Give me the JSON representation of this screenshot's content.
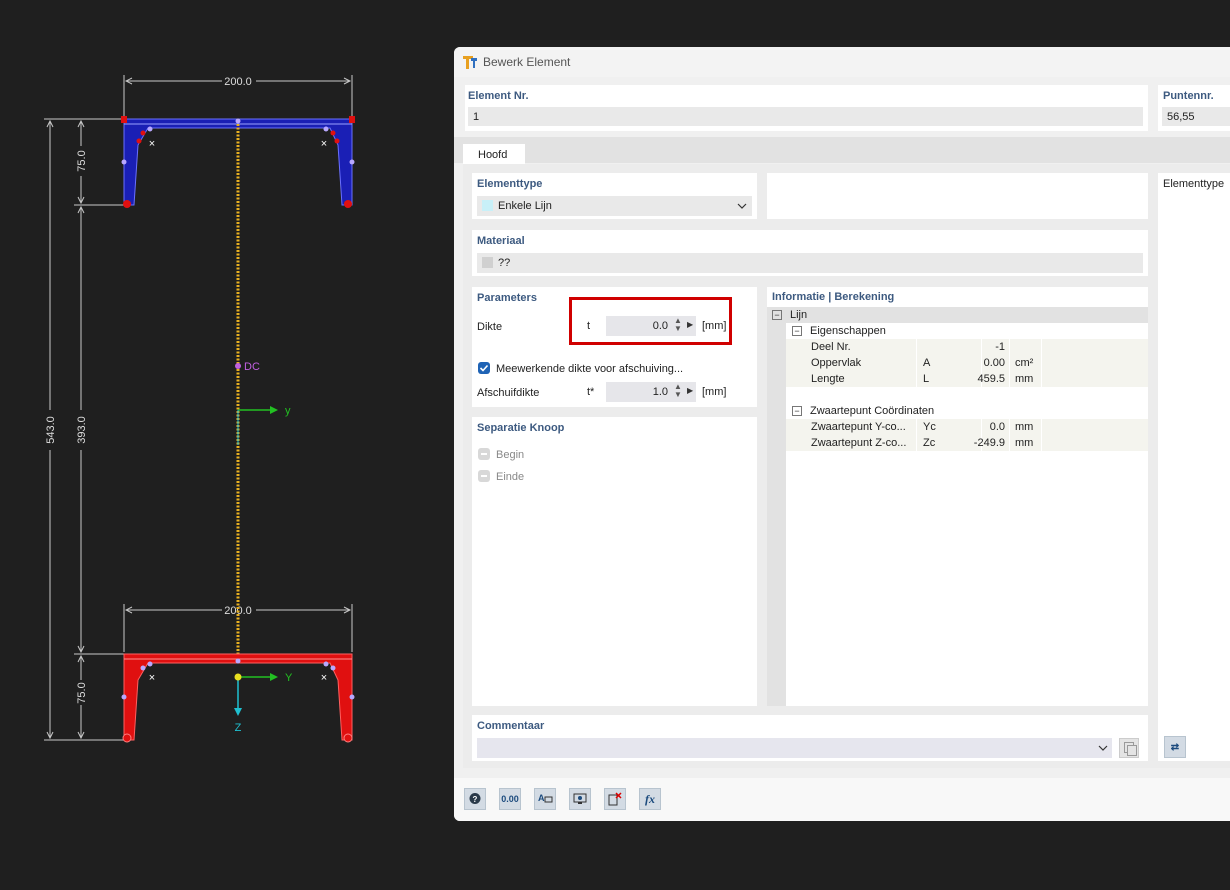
{
  "drawing": {
    "dim_top_width": "200.0",
    "dim_bottom_width": "200.0",
    "dim_left_total": "543.0",
    "dim_left_top_flange": "75.0",
    "dim_left_web": "393.0",
    "dim_left_bottom_flange": "75.0",
    "label_dc": "DC",
    "axis_y_mid": "y",
    "axis_y_bottom": "Y",
    "axis_z_bottom": "Z",
    "colors": {
      "top_flange": "#1a1fb5",
      "bottom_flange": "#e01010",
      "web": "#e8b020",
      "axis": "#22c022",
      "axis_z": "#1fc0d0",
      "dc": "#c060e0"
    }
  },
  "dialog": {
    "title": "Bewerk Element",
    "element_nr_label": "Element Nr.",
    "element_nr_value": "1",
    "punten_label": "Puntennr.",
    "punten_value": "56,55",
    "tab_main": "Hoofd",
    "elementtype_label": "Elementtype",
    "elementtype_value": "Enkele Lijn",
    "elementtype_right_label": "Elementtype",
    "materiaal_label": "Materiaal",
    "materiaal_value": "??",
    "parameters_label": "Parameters",
    "dikte_label": "Dikte",
    "dikte_symbol": "t",
    "dikte_value": "0.0",
    "dikte_unit": "[mm]",
    "shear_checkbox_label": "Meewerkende dikte voor afschuiving...",
    "afschuif_label": "Afschuifdikte",
    "afschuif_symbol": "t*",
    "afschuif_value": "1.0",
    "afschuif_unit": "[mm]",
    "separatie_label": "Separatie Knoop",
    "begin_label": "Begin",
    "einde_label": "Einde",
    "info_label": "Informatie | Berekening",
    "commentaar_label": "Commentaar"
  },
  "info_tree": {
    "root": "Lijn",
    "group1": "Eigenschappen",
    "rows1": [
      {
        "name": "Deel Nr.",
        "sym": "",
        "value": "-1",
        "unit": ""
      },
      {
        "name": "Oppervlak",
        "sym": "A",
        "value": "0.00",
        "unit": "cm²"
      },
      {
        "name": "Lengte",
        "sym": "L",
        "value": "459.5",
        "unit": "mm"
      }
    ],
    "group2": "Zwaartepunt Coördinaten",
    "rows2": [
      {
        "name": "Zwaartepunt Y-co...",
        "sym": "Yc",
        "value": "0.0",
        "unit": "mm"
      },
      {
        "name": "Zwaartepunt Z-co...",
        "sym": "Zc",
        "value": "-249.9",
        "unit": "mm"
      }
    ]
  },
  "toolbar": {
    "buttons": [
      "help-icon",
      "decimal-icon",
      "text-format-icon",
      "display-icon",
      "delete-selection-icon",
      "function-icon"
    ],
    "decimal_label": "0.00",
    "function_label": "fx"
  }
}
